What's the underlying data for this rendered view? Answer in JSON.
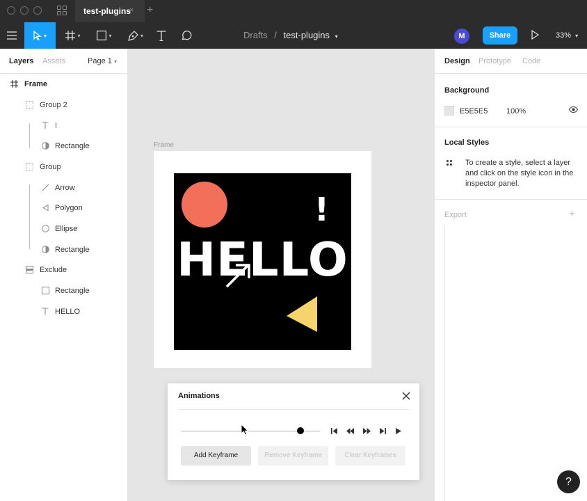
{
  "window": {
    "tab_title": "test-plugins",
    "tab_close": "×",
    "new_tab": "+"
  },
  "toolbar": {
    "breadcrumb_root": "Drafts",
    "breadcrumb_sep": "/",
    "file_name": "test-plugins",
    "avatar_initial": "M",
    "share_label": "Share",
    "zoom_label": "33%",
    "tools": [
      "menu-icon",
      "move-icon",
      "frame-icon",
      "shape-icon",
      "pen-icon",
      "text-icon",
      "comment-icon"
    ],
    "accent": "#18a0fb"
  },
  "left_panel": {
    "tabs": [
      "Layers",
      "Assets"
    ],
    "page_selector": "Page 1",
    "layers": [
      {
        "label": "Frame",
        "icon": "frame-icon"
      },
      {
        "label": "Group 2",
        "icon": "group-icon"
      },
      {
        "label": "!",
        "icon": "text-icon"
      },
      {
        "label": "Rectangle",
        "icon": "mask-icon"
      },
      {
        "label": "Group",
        "icon": "group-icon"
      },
      {
        "label": "Arrow",
        "icon": "line-icon"
      },
      {
        "label": "Polygon",
        "icon": "polygon-icon"
      },
      {
        "label": "Ellipse",
        "icon": "ellipse-icon"
      },
      {
        "label": "Rectangle",
        "icon": "mask-icon"
      },
      {
        "label": "Exclude",
        "icon": "boolean-icon"
      },
      {
        "label": "Rectangle",
        "icon": "rectangle-icon"
      },
      {
        "label": "HELLO",
        "icon": "text-icon"
      }
    ]
  },
  "canvas": {
    "frame_label": "Frame",
    "hello_text": "HELLO",
    "exclamation_text": "!",
    "circle_color": "#f2705a",
    "triangle_color": "#f7d36b"
  },
  "animations": {
    "title": "Animations",
    "timeline_progress": 0.86,
    "add_keyframe": "Add Keyframe",
    "remove_keyframe": "Remove Keyframe",
    "clear_keyframes": "Clear Keyframes"
  },
  "right_panel": {
    "tabs": [
      "Design",
      "Prototype",
      "Code"
    ],
    "background_title": "Background",
    "background_hex": "E5E5E5",
    "background_opacity": "100%",
    "local_styles_title": "Local Styles",
    "local_styles_text": "To create a style, select a layer and click on the style icon in the inspector panel.",
    "export_title": "Export",
    "export_add": "+"
  },
  "help_label": "?"
}
